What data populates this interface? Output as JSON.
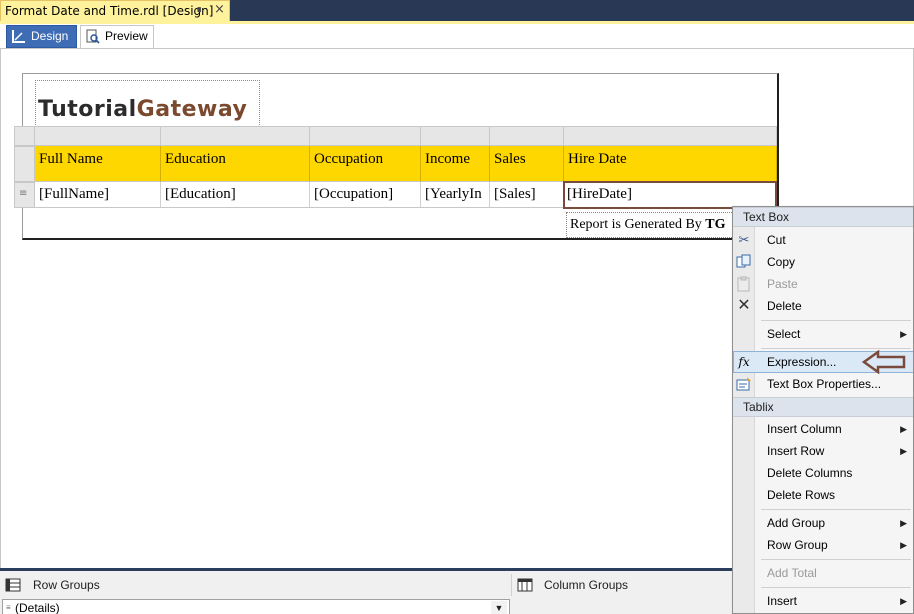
{
  "document_tab": {
    "title": "Format Date and Time.rdl [Design]",
    "pin_icon": "pin-icon",
    "close_icon": "close-icon"
  },
  "view_tabs": {
    "design": "Design",
    "preview": "Preview"
  },
  "logo": {
    "part1": "Tutorial",
    "part2": "Gateway",
    "colors": {
      "part1": "#2b2b2b",
      "part2": "#7b4a2e"
    }
  },
  "table": {
    "headers": [
      "Full Name",
      "Education",
      "Occupation",
      "Income",
      "Sales",
      "Hire Date"
    ],
    "fields": [
      "[FullName]",
      "[Education]",
      "[Occupation]",
      "[YearlyIn",
      "[Sales]",
      "[HireDate]"
    ],
    "header_color": "#ffd700",
    "selected_field": "[HireDate]"
  },
  "footer": {
    "text": "Report is Generated By ",
    "bold": "TG"
  },
  "group_pane": {
    "row_groups": "Row Groups",
    "column_groups": "Column Groups",
    "details": "(Details)"
  },
  "context_menu": {
    "section_textbox": "Text Box",
    "cut": "Cut",
    "copy": "Copy",
    "paste": "Paste",
    "delete": "Delete",
    "select": "Select",
    "expression": "Expression...",
    "textbox_properties": "Text Box Properties...",
    "section_tablix": "Tablix",
    "insert_column": "Insert Column",
    "insert_row": "Insert Row",
    "delete_columns": "Delete Columns",
    "delete_rows": "Delete Rows",
    "add_group": "Add Group",
    "row_group": "Row Group",
    "add_total": "Add Total",
    "insert": "Insert",
    "accent": "#7a4a3c"
  }
}
